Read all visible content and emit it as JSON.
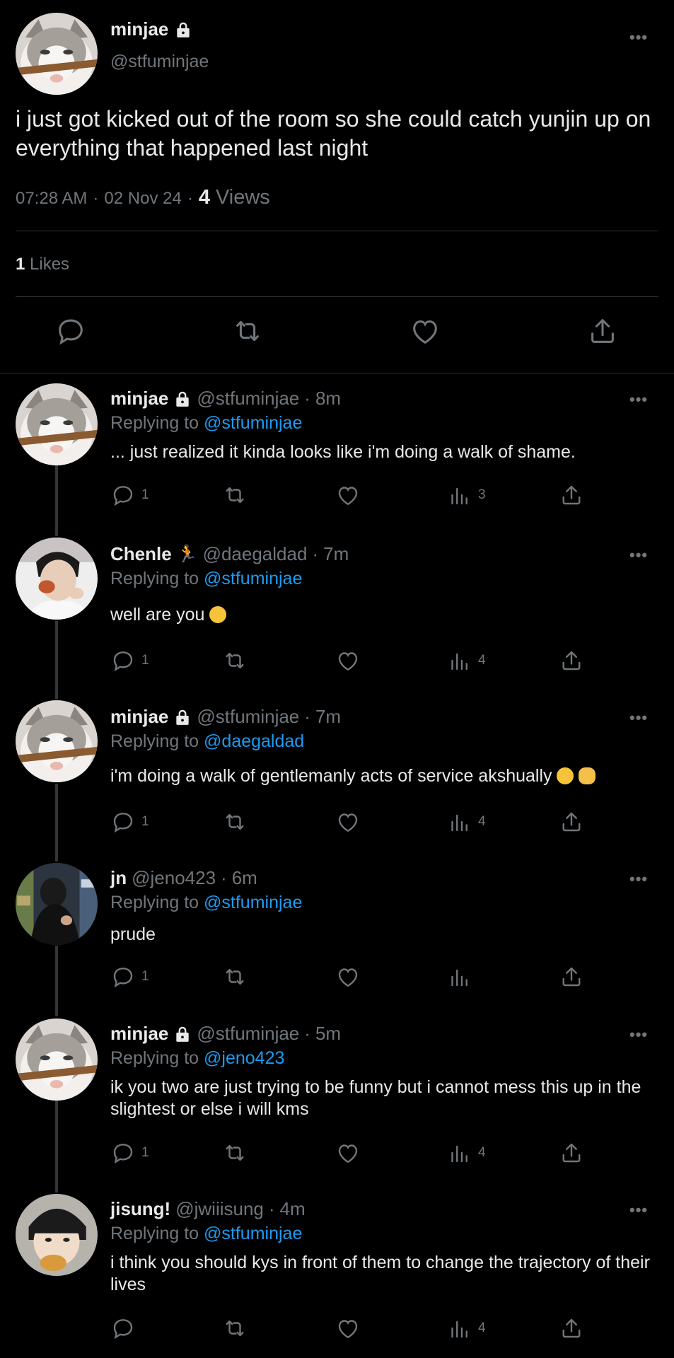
{
  "main": {
    "name": "minjae",
    "handle": "@stfuminjae",
    "text": "i just got kicked out of the room so she could catch yunjin up on everything that happened last night",
    "time": "07:28 AM",
    "date": "02 Nov 24",
    "views_count": "4",
    "views_label": "Views",
    "likes_count": "1",
    "likes_label": "Likes"
  },
  "replies": [
    {
      "name": "minjae",
      "handle": "@stfuminjae",
      "time": "8m",
      "replying_label": "Replying to",
      "replying_to": "@stfuminjae",
      "text": "... just realized it kinda looks like i'm doing a walk of shame.",
      "reply_count": "1",
      "views": "3"
    },
    {
      "name": "Chenle",
      "handle": "@daegaldad",
      "time": "7m",
      "replying_label": "Replying to",
      "replying_to": "@stfuminjae",
      "text": "well are you",
      "reply_count": "1",
      "views": "4"
    },
    {
      "name": "minjae",
      "handle": "@stfuminjae",
      "time": "7m",
      "replying_label": "Replying to",
      "replying_to": "@daegaldad",
      "text": "i'm doing a walk of gentlemanly acts of service akshually",
      "reply_count": "1",
      "views": "4"
    },
    {
      "name": "jn",
      "handle": "@jeno423",
      "time": "6m",
      "replying_label": "Replying to",
      "replying_to": "@stfuminjae",
      "text": "prude",
      "reply_count": "1",
      "views": ""
    },
    {
      "name": "minjae",
      "handle": "@stfuminjae",
      "time": "5m",
      "replying_label": "Replying to",
      "replying_to": "@jeno423",
      "text": "ik you two are just trying to be funny but i cannot mess this up in the slightest or else i will kms",
      "reply_count": "1",
      "views": "4"
    },
    {
      "name": "jisung!",
      "handle": "@jwiiisung",
      "time": "4m",
      "replying_label": "Replying to",
      "replying_to": "@stfuminjae",
      "text": "i think you should kys in front of them to change the trajectory of their lives",
      "reply_count": "",
      "views": "4"
    }
  ],
  "ui": {
    "separator": "·",
    "more": "•••"
  },
  "colors": {
    "background": "#000000",
    "text": "#e7e9ea",
    "muted": "#71767b",
    "link": "#1d9bf0",
    "divider": "#2f3336"
  }
}
